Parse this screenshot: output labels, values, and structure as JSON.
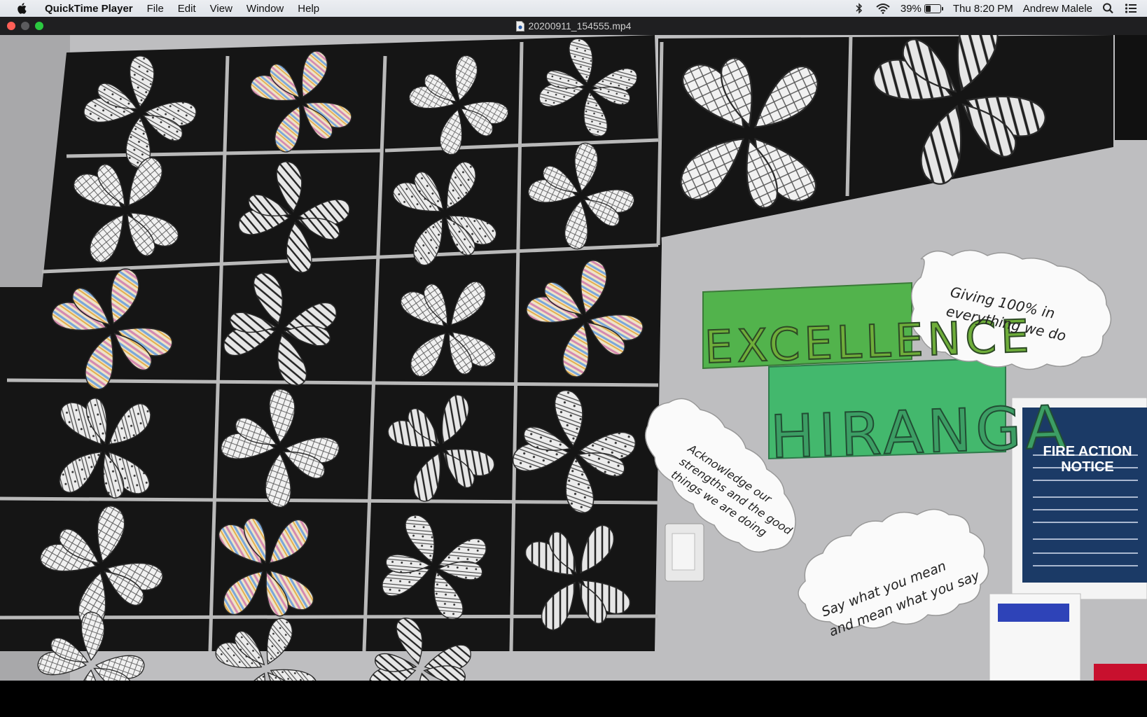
{
  "menubar": {
    "app_name": "QuickTime Player",
    "menus": [
      "File",
      "Edit",
      "View",
      "Window",
      "Help"
    ],
    "battery_percent": "39%",
    "battery_level": 0.39,
    "clock": "Thu 8:20 PM",
    "user": "Andrew Malele",
    "icons": [
      "apple-icon",
      "bluetooth-icon",
      "wifi-icon",
      "battery-icon",
      "spotlight-search-icon",
      "notification-center-icon"
    ]
  },
  "window": {
    "title": "20200911_154555.mp4",
    "controls": [
      "close",
      "minimize",
      "zoom"
    ]
  },
  "video": {
    "signs": {
      "excellence": "EXCELLENCE",
      "hiranga": "HIRANGA",
      "note_giving": "Giving 100% in everything we do",
      "note_acknowledge": "Acknowledge our strengths and the good things we are doing",
      "note_say": "Say what you mean and mean what you say",
      "fire_notice": "FIRE ACTION NOTICE"
    },
    "colors": {
      "wall": "#bdbdbf",
      "board": "#141414",
      "excellence_card": "#4fb24a",
      "hiranga_card": "#3fb46a",
      "fire_notice": "#1b3a66"
    }
  }
}
